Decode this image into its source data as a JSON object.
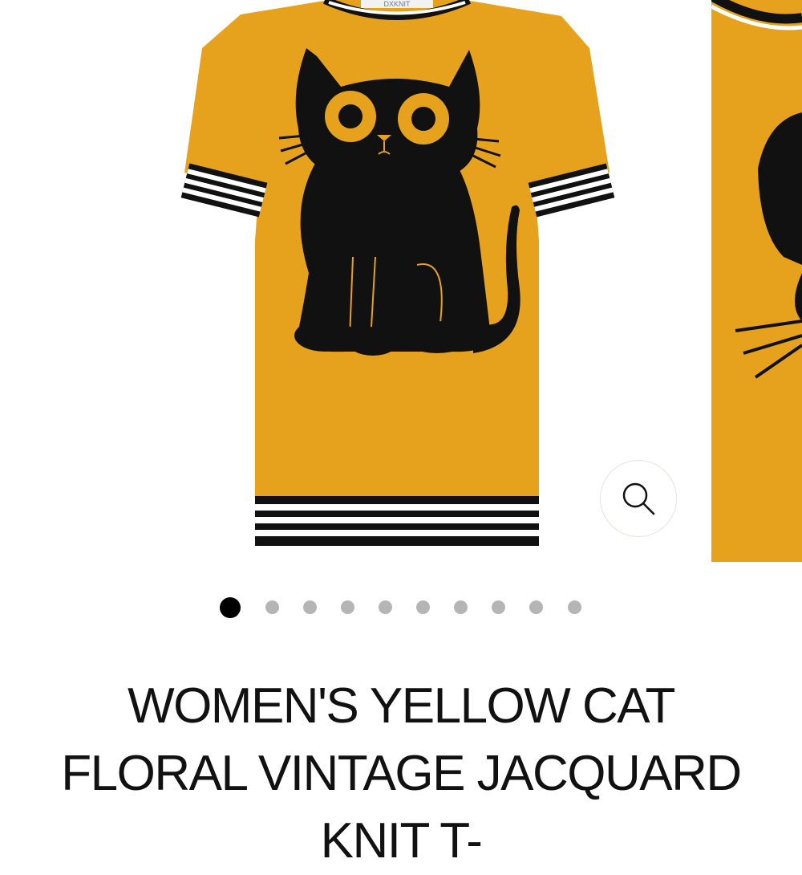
{
  "gallery": {
    "brand_label": "DXKNIT",
    "zoom_icon": "search-icon",
    "slide_count": 10,
    "active_index": 0
  },
  "product": {
    "title": "WOMEN'S YELLOW CAT FLORAL VINTAGE JACQUARD KNIT T-"
  },
  "colors": {
    "knit_yellow": "#e6a21d",
    "cat_black": "#111111",
    "dot_active": "#000000",
    "dot_inactive": "#b5b5b5"
  }
}
